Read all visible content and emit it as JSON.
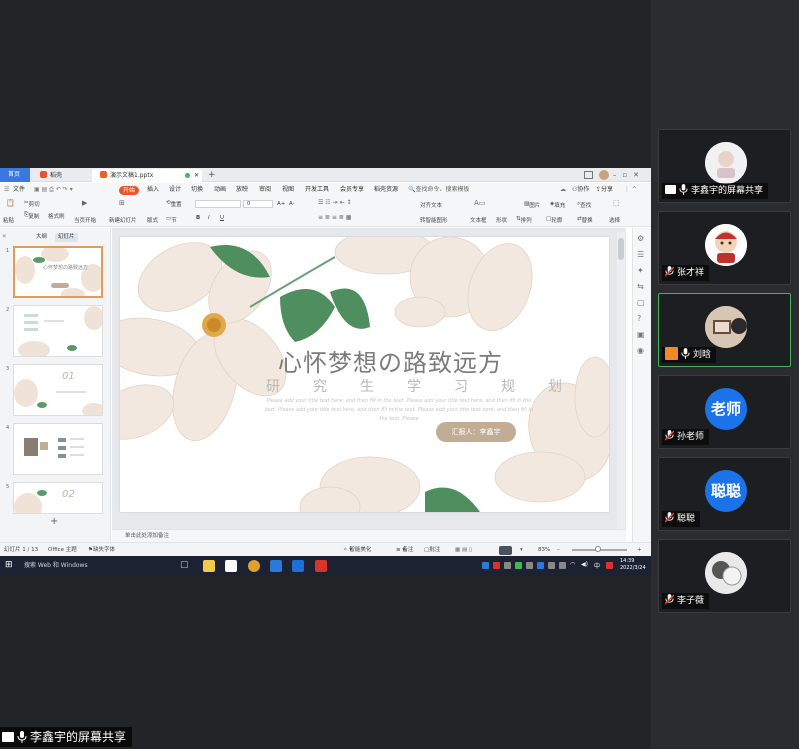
{
  "wps": {
    "tabs": {
      "home": "首页",
      "docer": "稻壳",
      "doc": "演示文稿1.pptx"
    },
    "menu": {
      "file": "文件",
      "start": "开始",
      "insert": "插入",
      "design": "设计",
      "switch": "切换",
      "animation": "动画",
      "slideshow": "放映",
      "review": "审阅",
      "view": "视图",
      "devtools": "开发工具",
      "member": "会员专享",
      "docer_res": "稻壳资源",
      "search": "查找命令、搜索模板",
      "collab": "协作",
      "share": "分享"
    },
    "ribbon": {
      "paste": "粘贴",
      "cut": "剪切",
      "copy": "复制",
      "format_painter": "格式刷",
      "play_current": "当页开始",
      "new_slide": "新建幻灯片",
      "layout": "版式",
      "section": "节",
      "reset": "重置",
      "bold": "B",
      "italic": "I",
      "underline": "U",
      "font_size": "0",
      "grow": "A+",
      "shrink": "A-",
      "align_text": "对齐文本",
      "convert_smartart": "转智能图形",
      "textbox": "文本框",
      "shape": "形状",
      "arrange": "排列",
      "picture": "图片",
      "fill": "填充",
      "outline": "轮廓",
      "find": "查找",
      "replace": "替换",
      "select": "选择"
    },
    "panel_tabs": {
      "outline": "大纲",
      "slides": "幻灯片"
    },
    "thumb_numbers": [
      "1",
      "2",
      "3",
      "4",
      "5"
    ],
    "thumbs": {
      "t1_title": "心怀梦想の路致远方",
      "t3_num": "01",
      "t5_num": "02"
    },
    "slide": {
      "title": "心怀梦想の路致远方",
      "subtitle": "研究生学习规划",
      "lorem": "Please add your title text here, and then fill in the text. Please add your title text here, and then fill in the text. Please add your title text here, and then fill in the text. Please add your title text here, and then fill in the text. Please",
      "reporter": "汇报人：李鑫宇"
    },
    "notes": "单击此处添加备注",
    "status": {
      "slide_count": "幻灯片 1 / 13",
      "theme": "Office 主题",
      "missing_font": "缺失字体",
      "smart_beautify": "智能美化",
      "notes": "备注",
      "comment": "批注",
      "zoom": "83%"
    }
  },
  "taskbar": {
    "search": "搜索 Web 和 Windows",
    "time": "14:39",
    "date": "2022/3/24"
  },
  "participants": [
    {
      "name": "李鑫宇的屏幕共享",
      "type": "screen"
    },
    {
      "name": "张才祥",
      "type": "muted"
    },
    {
      "name": "刘晗",
      "type": "host"
    },
    {
      "name": "孙老师",
      "type": "muted",
      "avatar_text": "老师"
    },
    {
      "name": "聪聪",
      "type": "muted",
      "avatar_text": "聪聪"
    },
    {
      "name": "李子薇",
      "type": "muted"
    }
  ],
  "share_label": "李鑫宇的屏幕共享",
  "colors": {
    "accent": "#e8532c",
    "tab_blue": "#3a78e0",
    "active_border": "#45b35c",
    "avatar_blue": "#1a73e8",
    "host_orange": "#f08a24"
  }
}
